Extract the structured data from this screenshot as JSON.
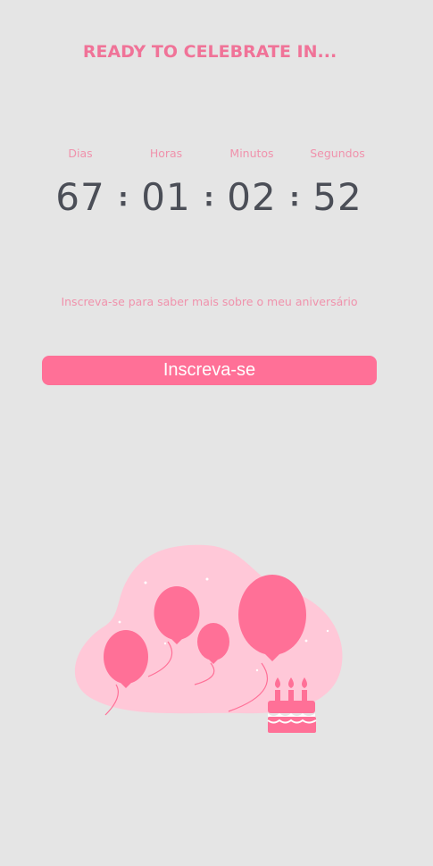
{
  "header": {
    "title": "READY TO CELEBRATE IN..."
  },
  "countdown": {
    "days": {
      "label": "Dias",
      "value": "67"
    },
    "hours": {
      "label": "Horas",
      "value": "01"
    },
    "minutes": {
      "label": "Minutos",
      "value": "02"
    },
    "seconds": {
      "label": "Segundos",
      "value": "52"
    },
    "separator": ":"
  },
  "signup": {
    "prompt": "Inscreva-se para saber mais sobre o meu aniversário",
    "button_label": "Inscreva-se"
  },
  "colors": {
    "background": "#e5e5e5",
    "accent": "#ff7097",
    "title": "#f07398",
    "label": "#f092ac",
    "digits": "#4b4e57",
    "blob": "#ffc8d8"
  },
  "illustration": {
    "icon": "balloons-birthday-cake-icon"
  }
}
